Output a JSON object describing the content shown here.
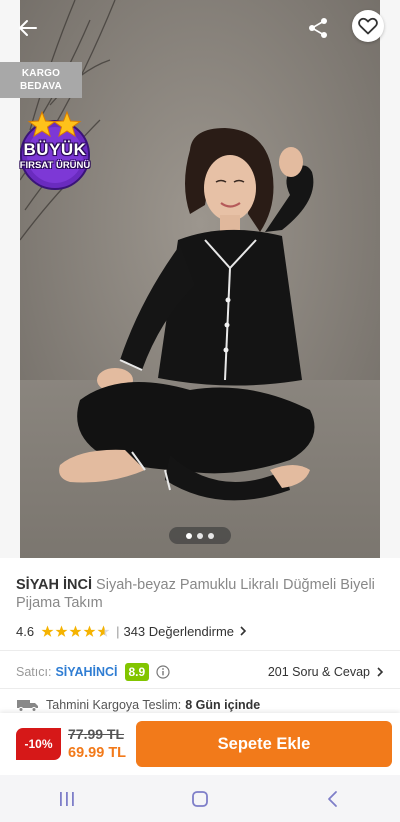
{
  "header": {
    "back_icon": "arrow-left-icon",
    "share_icon": "share-icon",
    "favorite_icon": "heart-icon"
  },
  "badges": {
    "kargo_line1": "KARGO",
    "kargo_line2": "BEDAVA",
    "firsat_line1": "BÜYÜK",
    "firsat_line2": "FIRSAT ÜRÜNÜ"
  },
  "carousel": {
    "dots": 3,
    "active_index": 0
  },
  "product": {
    "brand": "SİYAH İNCİ",
    "name": "Siyah-beyaz Pamuklu Likralı Düğmeli Biyeli Pijama Takım",
    "rating": "4.6",
    "rating_value": 4.6,
    "rating_max": 5,
    "review_count_text": "343 Değerlendirme"
  },
  "seller": {
    "label": "Satıcı:",
    "name": "SİYAHİNCİ",
    "score": "8.9",
    "qa_text": "201 Soru & Cevap"
  },
  "delivery": {
    "label": "Tahmini Kargoya Teslim:",
    "value": "8 Gün içinde"
  },
  "purchase": {
    "discount": "-10%",
    "old_price": "77.99 TL",
    "new_price": "69.99 TL",
    "cart_button": "Sepete Ekle"
  },
  "colors": {
    "accent_orange": "#f27a1a",
    "discount_red": "#d61818",
    "seller_blue": "#2f7dd3",
    "score_green": "#82c500",
    "star_yellow": "#f5b301"
  },
  "system_nav": {
    "recents_icon": "recents-icon",
    "home_icon": "home-icon",
    "back_icon": "nav-back-icon"
  }
}
